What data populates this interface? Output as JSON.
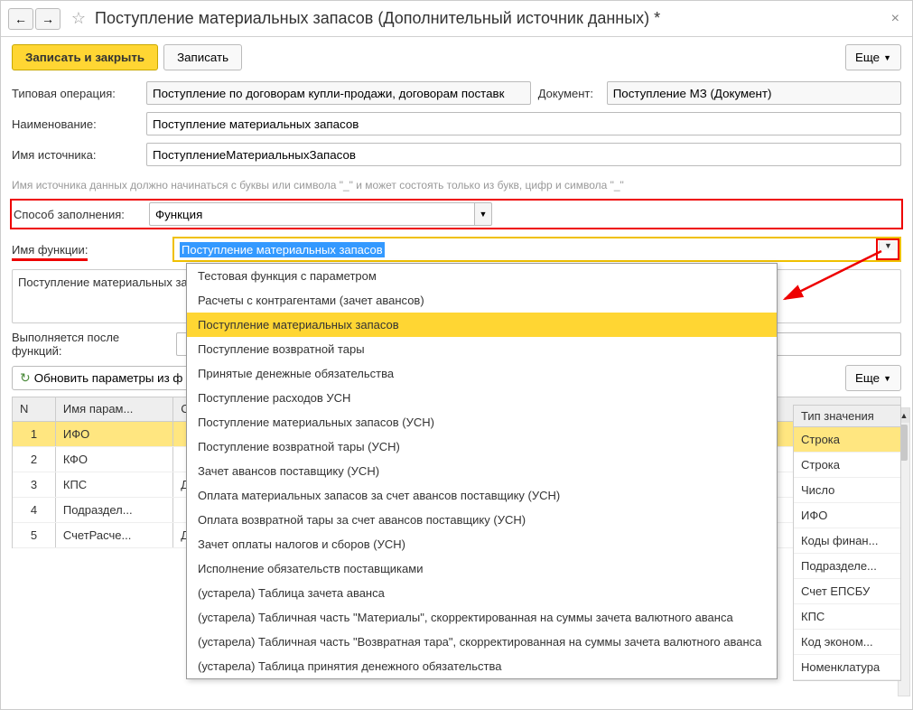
{
  "titlebar": {
    "title": "Поступление материальных запасов (Дополнительный источник данных) *"
  },
  "toolbar": {
    "save_close": "Записать и закрыть",
    "save": "Записать",
    "more": "Еще"
  },
  "fields": {
    "typical_op_label": "Типовая операция:",
    "typical_op_value": "Поступление по договорам купли-продажи, договорам поставк",
    "document_label": "Документ:",
    "document_value": "Поступление МЗ (Документ)",
    "name_label": "Наименование:",
    "name_value": "Поступление материальных запасов",
    "source_name_label": "Имя источника:",
    "source_name_value": "ПоступлениеМатериальныхЗапасов",
    "hint": "Имя источника данных должно начинаться с буквы или символа \"_\" и может состоять только из букв, цифр и символа \"_\"",
    "fill_method_label": "Способ заполнения:",
    "fill_method_value": "Функция",
    "fn_name_label": "Имя функции:",
    "fn_name_value": "Поступление материальных запасов",
    "description": "Поступление материальных за",
    "after_fn_label": "Выполняется после функций:",
    "refresh_params": "Обновить параметры из ф"
  },
  "table": {
    "headers": {
      "n": "N",
      "name": "Имя парам...",
      "d": "С",
      "type": "Тип значения"
    },
    "rows": [
      {
        "n": "1",
        "name": "ИФО",
        "d": "",
        "selected": true
      },
      {
        "n": "2",
        "name": "КФО",
        "d": ""
      },
      {
        "n": "3",
        "name": "КПС",
        "d": "Д"
      },
      {
        "n": "4",
        "name": "Подраздел...",
        "d": ""
      },
      {
        "n": "5",
        "name": "СчетРасче...",
        "d": "Д"
      }
    ]
  },
  "type_panel": {
    "header": "Тип значения",
    "items": [
      "Строка",
      "Строка",
      "Число",
      "ИФО",
      "Коды финан...",
      "Подразделе...",
      "Счет ЕПСБУ",
      "КПС",
      "Код эконом...",
      "Номенклатура"
    ]
  },
  "dropdown": {
    "items": [
      "Тестовая функция с параметром",
      "Расчеты с контрагентами (зачет авансов)",
      "Поступление материальных запасов",
      "Поступление возвратной тары",
      "Принятые денежные обязательства",
      "Поступление расходов УСН",
      "Поступление материальных запасов (УСН)",
      "Поступление возвратной тары (УСН)",
      "Зачет авансов поставщику (УСН)",
      "Оплата материальных запасов за счет авансов поставщику (УСН)",
      "Оплата возвратной тары за счет авансов поставщику (УСН)",
      "Зачет оплаты налогов и сборов (УСН)",
      "Исполнение обязательств поставщиками",
      "(устарела) Таблица зачета аванса",
      "(устарела) Табличная часть \"Материалы\", скорректированная на суммы зачета валютного аванса",
      "(устарела) Табличная часть \"Возвратная тара\", скорректированная на суммы зачета валютного аванса",
      "(устарела) Таблица принятия денежного обязательства"
    ],
    "highlighted_index": 2
  }
}
